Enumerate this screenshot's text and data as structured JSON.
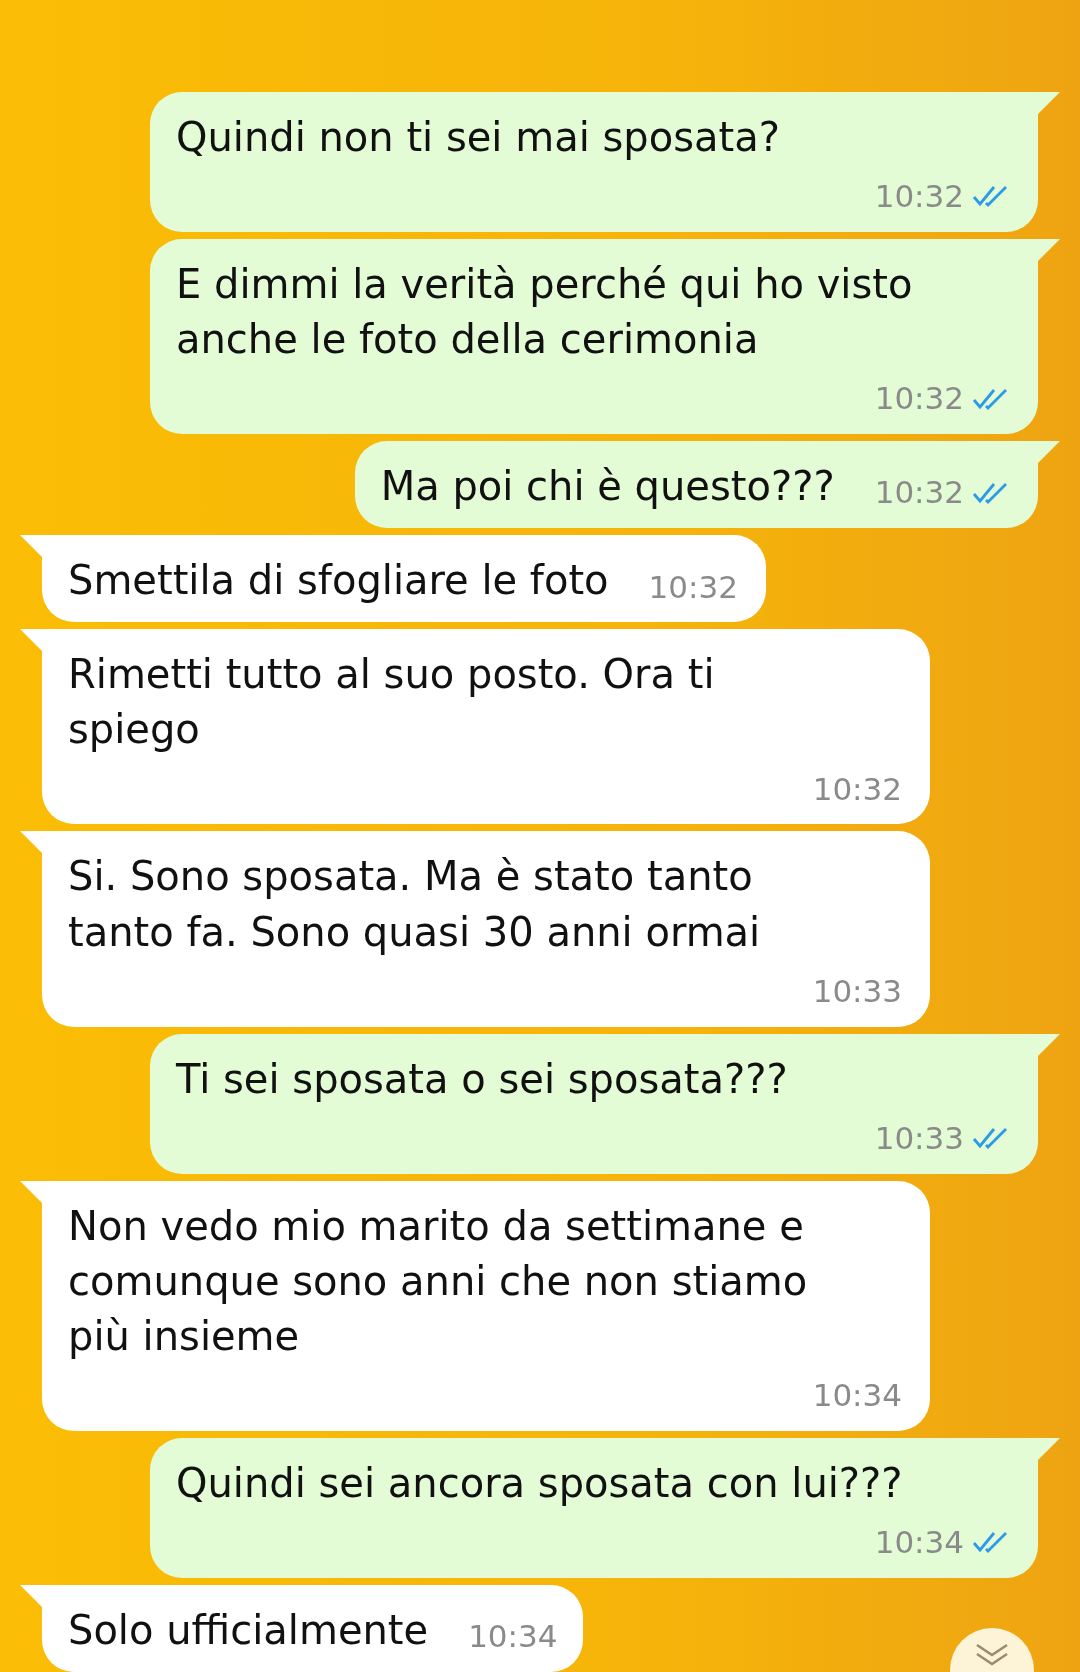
{
  "messages": [
    {
      "kind": "sent",
      "text": "Quindi non ti sei mai sposata?",
      "time": "10:32",
      "read": true
    },
    {
      "kind": "sent",
      "text": "E dimmi la verità perché qui ho visto anche le foto della cerimonia",
      "time": "10:32",
      "read": true
    },
    {
      "kind": "sent",
      "text": "Ma poi chi è questo???",
      "time": "10:32",
      "read": true
    },
    {
      "kind": "received",
      "text": "Smettila di sfogliare le foto",
      "time": "10:32"
    },
    {
      "kind": "received",
      "text": "Rimetti tutto al suo posto. Ora ti spiego",
      "time": "10:32"
    },
    {
      "kind": "received",
      "text": "Si. Sono sposata. Ma è stato tanto tanto fa. Sono quasi 30 anni ormai",
      "time": "10:33"
    },
    {
      "kind": "sent",
      "text": "Ti sei sposata o sei sposata???",
      "time": "10:33",
      "read": true
    },
    {
      "kind": "received",
      "text": "Non vedo mio marito da settimane e comunque sono anni che non stiamo più insieme",
      "time": "10:34"
    },
    {
      "kind": "sent",
      "text": "Quindi sei ancora sposata con lui???",
      "time": "10:34",
      "read": true
    },
    {
      "kind": "received",
      "text": "Solo ufficialmente",
      "time": "10:34"
    }
  ]
}
